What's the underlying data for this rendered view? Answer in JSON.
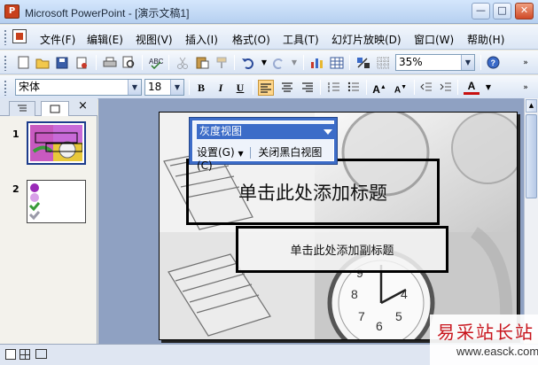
{
  "window": {
    "app_name": "Microsoft PowerPoint",
    "document_title": "[演示文稿1]",
    "minimize_label": "—",
    "maximize_label": "□",
    "close_label": "✕"
  },
  "menu": {
    "items": [
      "文件(F)",
      "编辑(E)",
      "视图(V)",
      "插入(I)",
      "格式(O)",
      "工具(T)",
      "幻灯片放映(D)",
      "窗口(W)",
      "帮助(H)"
    ]
  },
  "standard_toolbar": {
    "zoom": "35%"
  },
  "formatting_toolbar": {
    "font_name": "宋体",
    "font_size": "18",
    "bold_label": "B",
    "italic_label": "I",
    "underline_label": "U"
  },
  "left_panel": {
    "close_label": "×",
    "slides": [
      {
        "number": "1"
      },
      {
        "number": "2"
      }
    ]
  },
  "slide": {
    "title_placeholder": "单击此处添加标题",
    "subtitle_placeholder": "单击此处添加副标题"
  },
  "grayscale_toolbar": {
    "mode": "灰度视图",
    "settings_label": "设置(G)",
    "close_label": "关闭黑白视图(C)"
  },
  "watermark": {
    "cn": "易采站长站",
    "en": "www.easck.com"
  },
  "colors": {
    "title_bar": "#c4dbf6",
    "toolbar_blue": "#3c6cc8",
    "workspace": "#8fa1c2",
    "watermark_red": "#c8141c"
  }
}
